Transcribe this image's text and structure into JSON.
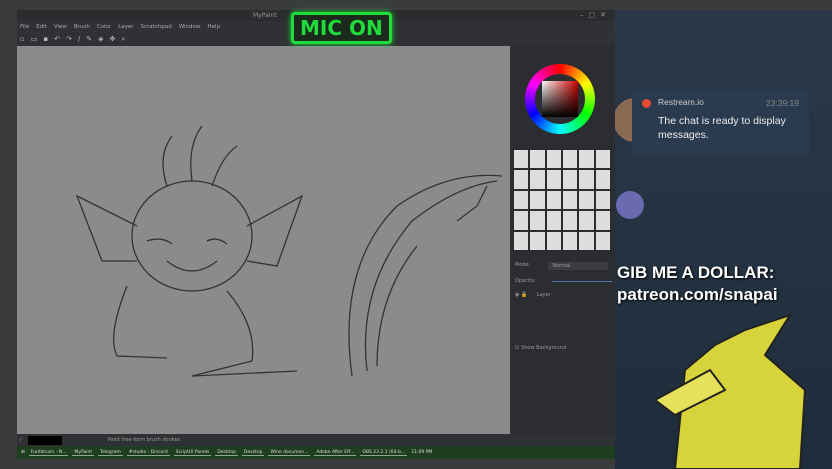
{
  "app": {
    "title": "MyPaint",
    "menu": [
      "File",
      "Edit",
      "View",
      "Brush",
      "Color",
      "Layer",
      "Scratchpad",
      "Window",
      "Help"
    ],
    "status": "Paint free-form brush strokes"
  },
  "mic": "MIC ON",
  "layers": {
    "mode_label": "Mode:",
    "mode_value": "Normal",
    "opacity_label": "Opacity:",
    "layer_name": "Layer",
    "show_background": "Show Background",
    "opacity": 0.95
  },
  "taskbar": {
    "items": [
      "Funfatcoin - N...",
      "MyPaint",
      "Telegram",
      "#studio - Discord",
      "ScriptUI Panels",
      "Desktop",
      "Desktop",
      "Wine documen...",
      "Adobe After Eff...",
      "OBS 23.2.1 (64-b..."
    ],
    "clock": "11:09 PM"
  },
  "chat": {
    "source": "Restream.io",
    "time": "23:39:19",
    "message": "The chat is ready to display messages."
  },
  "overlay": {
    "line1": "GIB ME A DOLLAR:",
    "line2": "patreon.com/snapai"
  }
}
